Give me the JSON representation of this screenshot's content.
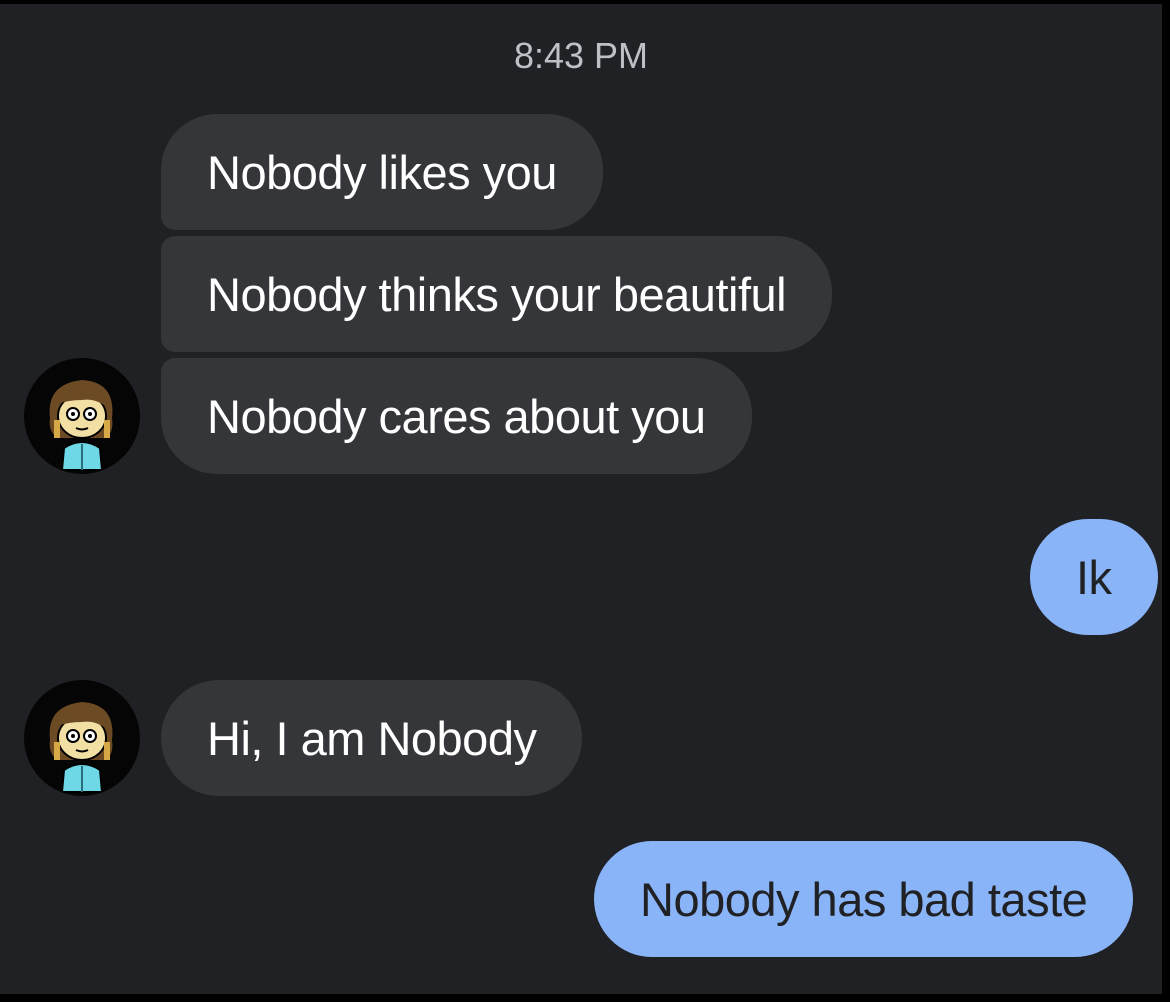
{
  "conversation": {
    "timestamp": "8:43 PM",
    "messages": [
      {
        "text": "Nobody likes you"
      },
      {
        "text": "Nobody thinks your beautiful"
      },
      {
        "text": "Nobody cares about you"
      },
      {
        "text": "Ik"
      },
      {
        "text": "Hi, I am Nobody"
      },
      {
        "text": "Nobody has bad taste"
      }
    ]
  },
  "contact": {
    "avatar_icon": "cartoon-character-avatar"
  },
  "colors": {
    "background": "#202124",
    "incoming_bubble": "#35363a",
    "outgoing_bubble": "#8ab4f8"
  }
}
